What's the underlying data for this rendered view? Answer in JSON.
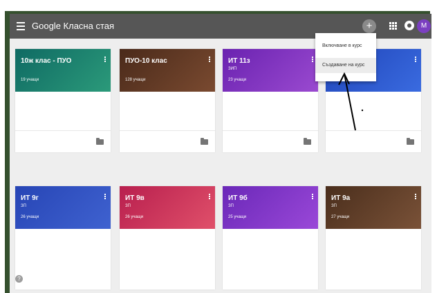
{
  "app": {
    "title": "Google Класна стая",
    "avatar_initial": "M",
    "plus_symbol": "+"
  },
  "colors": {
    "topbar": "#565656",
    "frame": "#35502e",
    "avatar": "#7b3fc1"
  },
  "menu": {
    "items": [
      {
        "label": "Включване в курс"
      },
      {
        "label": "Създаване на курс"
      }
    ]
  },
  "courses": [
    {
      "title": "10ж клас - ПУО",
      "section": "",
      "students": "19 учащи",
      "color": "#1f7f72"
    },
    {
      "title": "ПУО-10 клас",
      "section": "",
      "students": "128 учащи",
      "color": "#6b3a22"
    },
    {
      "title": "ИТ 11з",
      "section": "ЗИП",
      "students": "23 учащи",
      "color": "#7d2fbd"
    },
    {
      "title": "",
      "section": "",
      "students": "",
      "color": "#2a56c9"
    },
    {
      "title": "ИТ 9г",
      "section": "ЗП",
      "students": "26 учащи",
      "color": "#2d4fc0"
    },
    {
      "title": "ИТ 9в",
      "section": "ЗП",
      "students": "26 учащи",
      "color": "#c62a5a"
    },
    {
      "title": "ИТ 9б",
      "section": "ЗП",
      "students": "25 учащи",
      "color": "#7e33c6"
    },
    {
      "title": "ИТ 9а",
      "section": "ЗП",
      "students": "27 учащи",
      "color": "#5b3a24"
    }
  ],
  "icons": {
    "menu": "hamburger-icon",
    "add": "plus-icon",
    "apps": "apps-grid-icon",
    "account": "account-icon",
    "folder": "folder-icon",
    "help": "help-icon",
    "more": "kebab-icon"
  },
  "help_symbol": "?"
}
